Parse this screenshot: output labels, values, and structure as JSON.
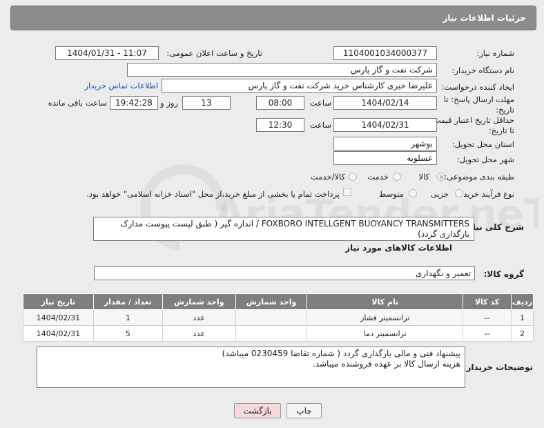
{
  "header": {
    "title": "جزئیات اطلاعات نیاز"
  },
  "form": {
    "need_number": {
      "label": "شماره نیاز:",
      "value": "1104001034000377"
    },
    "announce": {
      "label": "تاریخ و ساعت اعلان عمومی:",
      "value": "1404/01/31 - 11:07"
    },
    "buyer_org": {
      "label": "نام دستگاه خریدار:",
      "value": "شرکت نفت و گاز پارس"
    },
    "creator": {
      "label": "ایجاد کننده درخواست:",
      "value": "علیرضا  خیری کارشناس خرید  شرکت نفت و گاز پارس",
      "contact_link": "اطلاعات تماس خریدار"
    },
    "deadline": {
      "label_line1": "مهلت ارسال پاسخ: تا",
      "label_line2": "تاریخ:",
      "date": "1404/02/14",
      "time_label": "ساعت",
      "time": "08:00",
      "days": "13",
      "days_label": "روز و",
      "remaining": "19:42:28",
      "remaining_label": "ساعت باقی مانده"
    },
    "validity": {
      "label_line1": "حداقل تاریخ اعتبار قیمت:",
      "label_line2": "تا تاریخ:",
      "date": "1404/02/31",
      "time_label": "ساعت",
      "time": "12:30"
    },
    "province": {
      "label": "استان محل تحویل:",
      "value": "بوشهر"
    },
    "city": {
      "label": "شهر محل تحویل:",
      "value": "عسلویه"
    },
    "category": {
      "label": "طبقه بندی موضوعی:",
      "options": [
        "کالا",
        "خدمت",
        "کالا/خدمت"
      ],
      "selected": "کالا"
    },
    "process": {
      "label": "نوع فرآیند خرید :",
      "options": [
        "جزیی",
        "متوسط"
      ],
      "selected": "جزیی",
      "payment_note": "پرداخت تمام یا بخشی از مبلغ خرید،از محل \"اسناد خزانه اسلامی\" خواهد بود."
    },
    "description": {
      "label": "شرح کلی نیاز:",
      "value": "FOXBORO INTELLGENT BUOYANCY TRANSMITTERS / اندازه گیر ( طبق لیست پیوست مدارک بارگذاری گردد)"
    },
    "goods_title": "اطلاعات کالاهای مورد نیاز",
    "goods_group": {
      "label": "گروه کالا:",
      "value": "تعمیر و نگهداری"
    }
  },
  "table": {
    "columns": [
      "ردیف",
      "کد کالا",
      "نام کالا",
      "واحد شمارش",
      "تعداد / مقدار",
      "تاریخ نیاز"
    ],
    "rows": [
      [
        "1",
        "--",
        "ترانسمیتر فشار",
        "عدد",
        "1",
        "1404/02/31"
      ],
      [
        "2",
        "--",
        "ترانسمیتر دما",
        "عدد",
        "5",
        "1404/02/31"
      ]
    ]
  },
  "buyer_notes": {
    "label": "توضیحات خریدار:",
    "line1": "پیشنهاد فنی و مالی بارگذاری گردد ( شماره تقاضا 0230459 میباشد)",
    "line2": "هزینه ارسال کالا بر عهده فروشنده میباشد."
  },
  "buttons": {
    "print": "چاپ",
    "back": "بازگشت"
  },
  "watermark": {
    "text": "AriaTender.neT"
  },
  "colors": {
    "header": "#8c8c8c",
    "table_header": "#7e7e7e",
    "link": "#1a4fb5",
    "back_button": "#f7d9dc"
  }
}
